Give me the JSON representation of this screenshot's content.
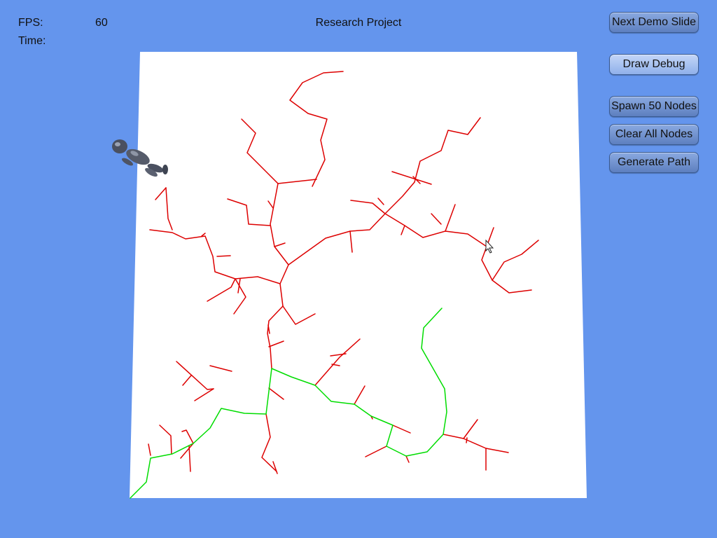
{
  "hud": {
    "fps_label": "FPS:",
    "fps_value": "60",
    "time_label": "Time:",
    "title": "Research Project"
  },
  "buttons": {
    "next_demo_slide": "Next Demo Slide",
    "draw_debug": "Draw Debug",
    "spawn_nodes": "Spawn 50 Nodes",
    "clear_nodes": "Clear All Nodes",
    "generate_path": "Generate Path"
  },
  "colors": {
    "background": "#6495ed",
    "plane": "#ffffff",
    "tree_edges": "#dd0000",
    "path_edges": "#00dd00",
    "button": "#7d9dd6"
  },
  "scene": {
    "agent_icon": "humanoid-agent-icon",
    "cursor_icon": "mouse-pointer-icon"
  }
}
